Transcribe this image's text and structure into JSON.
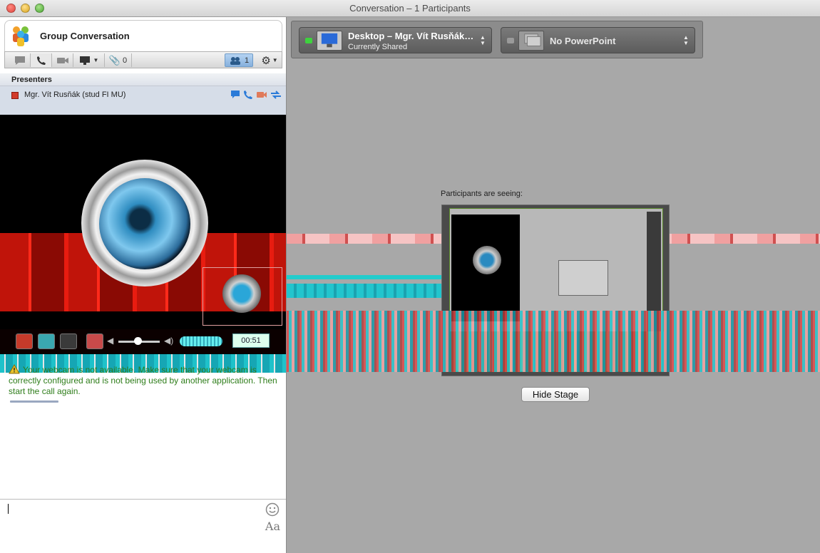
{
  "window": {
    "title": "Conversation – 1 Participants"
  },
  "conversation": {
    "title": "Group Conversation",
    "attachments_count": "0",
    "participants_count": "1"
  },
  "presenters": {
    "header": "Presenters",
    "items": [
      {
        "name": "Mgr. Vít Rusňák (stud FI MU)",
        "status_color": "#d23a2a"
      }
    ]
  },
  "video": {
    "timer": "00:51"
  },
  "warning": {
    "text": "Your webcam is not available. Make sure that your webcam is correctly configured and is not being used by another application. Then start the call again."
  },
  "composer": {
    "font_button": "Aa"
  },
  "sharing": {
    "desktop": {
      "title": "Desktop – Mgr. Vít Rusňák…",
      "subtitle": "Currently Shared",
      "led_color": "#3ed23e"
    },
    "powerpoint": {
      "title": "No PowerPoint",
      "led_color": "#9a9a9a"
    }
  },
  "stage": {
    "label": "Participants are seeing:",
    "hide_button": "Hide Stage"
  }
}
